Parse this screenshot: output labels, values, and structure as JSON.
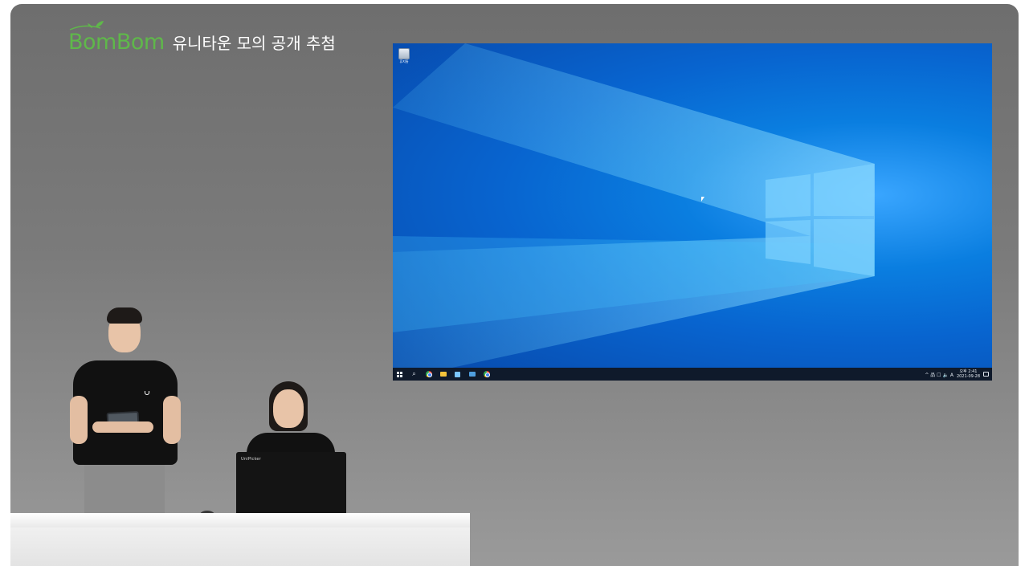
{
  "broadcast": {
    "logo_text": "BomBom",
    "title": "유니타운 모의 공개 추첨"
  },
  "desktop": {
    "icons": [
      {
        "label": "휴지통",
        "icon": "recycle-bin-icon"
      }
    ],
    "taskbar": {
      "apps": [
        "windows-start-icon",
        "search-icon",
        "chrome-icon",
        "file-explorer-icon",
        "app-icon",
        "mail-icon",
        "chrome-icon"
      ],
      "tray_text": "^ 品 ☐ 🔈 A",
      "time": "오후 2:41",
      "date": "2021-09-28"
    }
  },
  "set": {
    "laptop_label": "UniPicker"
  },
  "colors": {
    "brand_green": "#5fb84a",
    "backdrop_gray": "#7b7b7b",
    "desktop_blue": "#0a7ee0",
    "taskbar": "#0f1a2b"
  }
}
